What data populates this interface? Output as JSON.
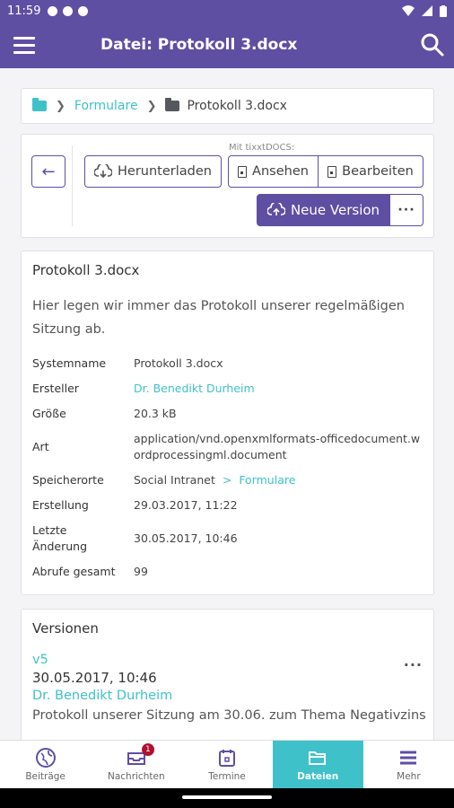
{
  "status": {
    "time": "11:59"
  },
  "appbar": {
    "title": "Datei: Protokoll 3.docx"
  },
  "breadcrumb": {
    "folder": "Formulare",
    "current": "Protokoll 3.docx"
  },
  "toolbar": {
    "download": "Herunterladen",
    "tixxt_label": "Mit tixxtDOCS:",
    "view": "Ansehen",
    "edit": "Bearbeiten",
    "new_version": "Neue Version",
    "more": "···"
  },
  "details": {
    "title": "Protokoll 3.docx",
    "description": "Hier legen wir immer das Protokoll unserer regelmäßigen Sitzung ab.",
    "rows": [
      {
        "key": "Systemname",
        "value": "Protokoll 3.docx"
      },
      {
        "key": "Ersteller",
        "value": "Dr. Benedikt Durheim"
      },
      {
        "key": "Größe",
        "value": "20.3 kB"
      },
      {
        "key": "Art",
        "value": "application/vnd.openxmlformats-officedocument.wordprocessingml.document"
      },
      {
        "key": "Speicherorte",
        "value_prefix": "Social Intranet",
        "value_sep": ">",
        "value_link": "Formulare"
      },
      {
        "key": "Erstellung",
        "value": "29.03.2017, 11:22"
      },
      {
        "key": "Letzte Änderung",
        "value": "30.05.2017, 10:46"
      },
      {
        "key": "Abrufe gesamt",
        "value": "99"
      }
    ]
  },
  "versions": {
    "title": "Versionen",
    "items": [
      {
        "tag": "v5",
        "more": "···",
        "date": "30.05.2017, 10:46",
        "author": "Dr. Benedikt Durheim",
        "note": "Protokoll unserer Sitzung am 30.06. zum Thema Negativzins"
      }
    ]
  },
  "bottomnav": {
    "items": [
      {
        "label": "Beiträge"
      },
      {
        "label": "Nachrichten",
        "badge": "1"
      },
      {
        "label": "Termine"
      },
      {
        "label": "Dateien"
      },
      {
        "label": "Mehr"
      }
    ],
    "active": "Dateien"
  },
  "colors": {
    "primary": "#5e4fa3",
    "accent": "#3fc1c9",
    "badge": "#b01030"
  }
}
